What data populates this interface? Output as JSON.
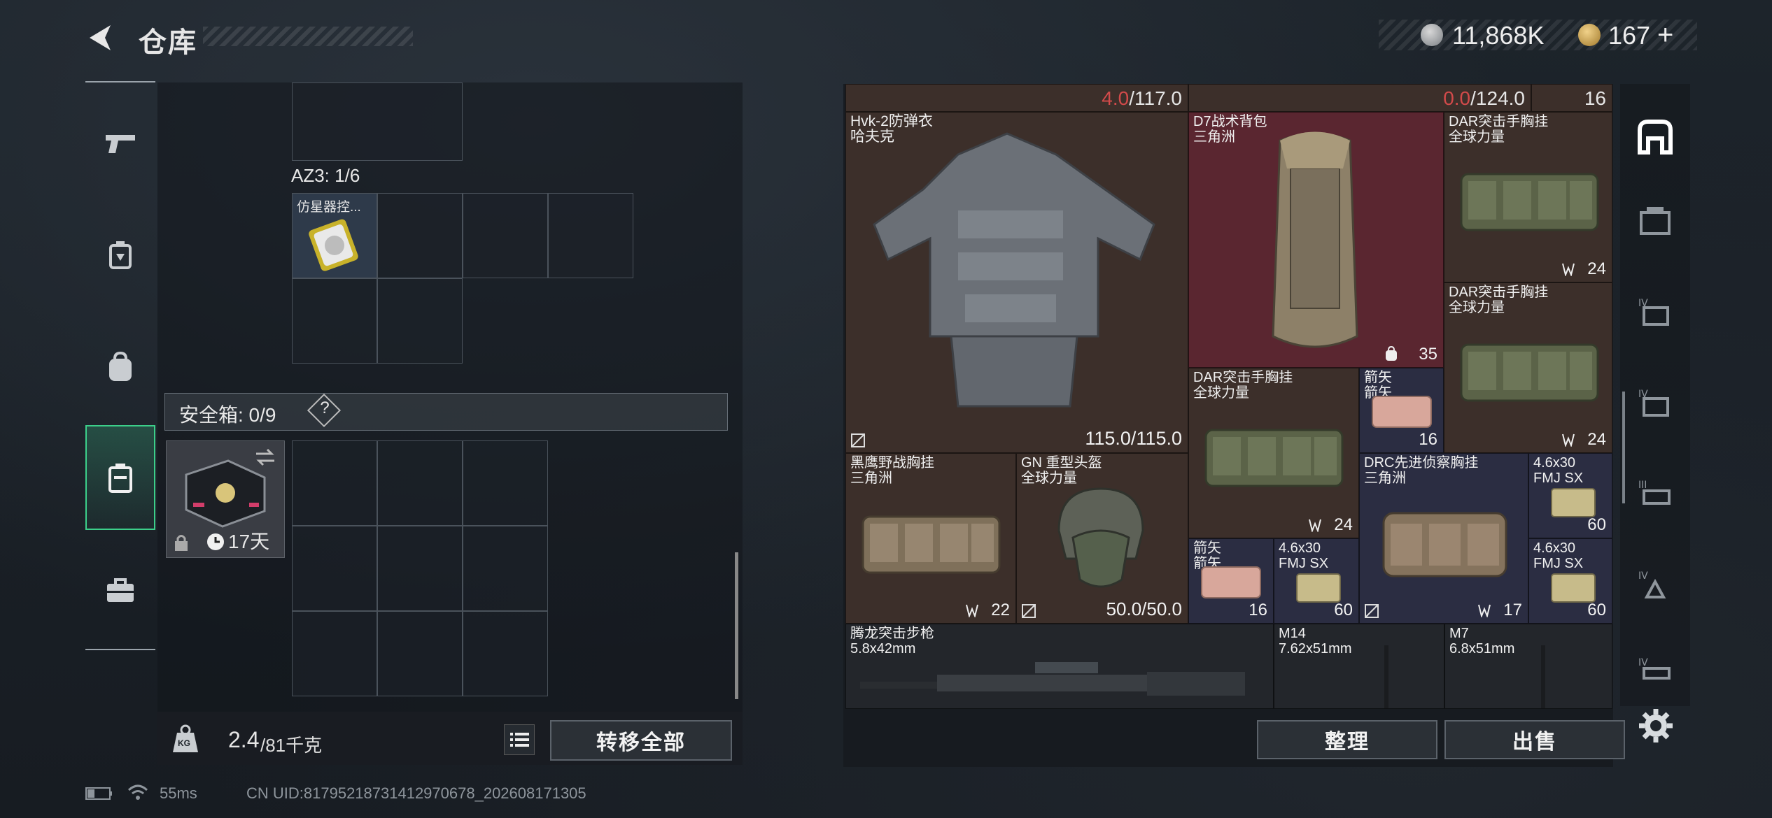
{
  "header": {
    "title": "仓库",
    "currency1": "11,868K",
    "currency2": "167",
    "currency2_plus": "+"
  },
  "left_panel": {
    "container_label": "AZ3: 1/6",
    "item_name": "仿星器控...",
    "safebox_label": "安全箱: 0/9",
    "safebox_help": "?",
    "safebox_timer": "17天",
    "weight": "2.4",
    "weight_max": "/81千克",
    "weight_icon_text": "KG",
    "transfer_all": "转移全部"
  },
  "right_panel": {
    "top_row": {
      "val1_red": "4.0",
      "val1_max": "/117.0",
      "val2_red": "0.0",
      "val2_max": "/124.0",
      "count": "16"
    },
    "tiles": [
      {
        "name": "Hvk-2防弹衣",
        "sub": "哈夫克",
        "count": "115.0/115.0"
      },
      {
        "name": "D7战术背包",
        "sub": "三角洲",
        "count": "35"
      },
      {
        "name": "DAR突击手胸挂",
        "sub": "全球力量",
        "count": "24"
      },
      {
        "name": "DAR突击手胸挂",
        "sub": "全球力量",
        "count": "24"
      },
      {
        "name": "DAR突击手胸挂",
        "sub": "全球力量",
        "count": "24"
      },
      {
        "name": "箭矢",
        "sub": "箭矢",
        "count": "16"
      },
      {
        "name": "黑鹰野战胸挂",
        "sub": "三角洲",
        "count": "22"
      },
      {
        "name": "GN 重型头盔",
        "sub": "全球力量",
        "count": "50.0/50.0"
      },
      {
        "name": "DRC先进侦察胸挂",
        "sub": "三角洲",
        "count": "17"
      },
      {
        "name": "4.6x30",
        "sub": "FMJ SX",
        "count": "60"
      },
      {
        "name": "4.6x30",
        "sub": "FMJ SX",
        "count": "60"
      },
      {
        "name": "箭矢",
        "sub": "箭矢",
        "count": "16"
      },
      {
        "name": "4.6x30",
        "sub": "FMJ SX",
        "count": "60"
      },
      {
        "name": "腾龙突击步枪",
        "sub": "5.8x42mm",
        "count": ""
      },
      {
        "name": "M14",
        "sub": "7.62x51mm",
        "count": ""
      },
      {
        "name": "M7",
        "sub": "6.8x51mm",
        "count": ""
      }
    ],
    "sort_button": "整理",
    "sell_button": "出售"
  },
  "status_bar": {
    "ping": "55ms",
    "uid": "CN UID:817952187314129706​78_202608171305"
  },
  "colors": {
    "accent_green": "#3ccf8a",
    "red_value": "#d24a4a",
    "item_brown": "#3c2f2a",
    "item_red": "#5a2630",
    "item_navy": "#2b2d42"
  }
}
